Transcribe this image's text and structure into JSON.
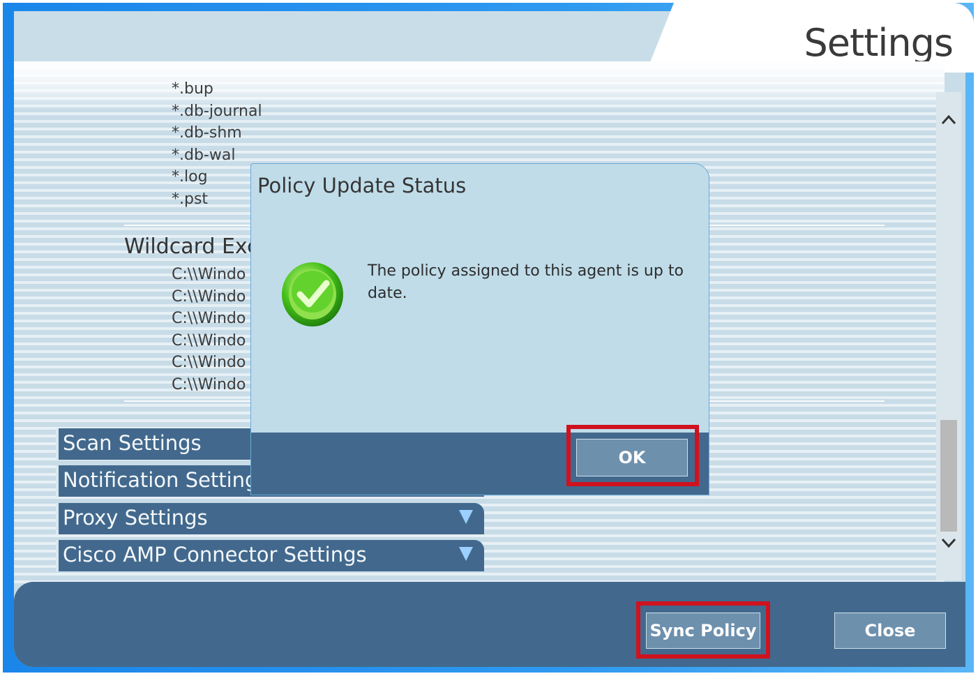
{
  "window": {
    "title": "Settings"
  },
  "extensions": [
    "*.bup",
    "*.db-journal",
    "*.db-shm",
    "*.db-wal",
    "*.log",
    "*.pst"
  ],
  "wildcard_section": {
    "title": "Wildcard Excl"
  },
  "wildcard_paths": [
    "C:\\\\Windo",
    "C:\\\\Windo",
    "C:\\\\Windo",
    "C:\\\\Windo",
    "C:\\\\Windo",
    "C:\\\\Windo"
  ],
  "accordions": [
    {
      "label": "Scan Settings"
    },
    {
      "label": "Notification Settings"
    },
    {
      "label": "Proxy Settings"
    },
    {
      "label": "Cisco AMP Connector Settings"
    }
  ],
  "dialog": {
    "title": "Policy Update Status",
    "message": "The policy assigned to this agent is up to date.",
    "ok_label": "OK",
    "icon": "success-check-icon"
  },
  "footer": {
    "sync_label": "Sync Policy",
    "close_label": "Close"
  },
  "scrollbar": {
    "up_glyph": "^",
    "down_glyph": "v"
  },
  "colors": {
    "accent": "#42698d",
    "highlight": "#d0121e",
    "window_blue": "#1a86ea"
  }
}
